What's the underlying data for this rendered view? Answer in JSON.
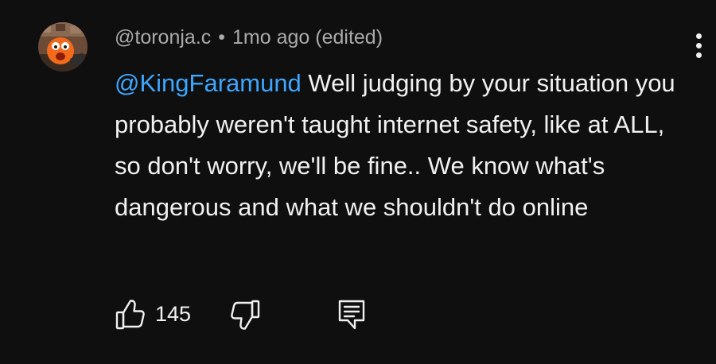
{
  "comment": {
    "author": "@toronja.c",
    "separator": "•",
    "timestamp": "1mo ago (edited)",
    "mention": "@KingFaramund",
    "text": " Well judging by your situation you probably weren't taught internet safety, like at ALL, so don't worry, we'll be fine.. We know what's dangerous and what we shouldn't do online",
    "like_count": "145"
  },
  "icons": {
    "avatar": "avatar",
    "menu": "more-vertical-icon",
    "like": "thumbs-up-icon",
    "dislike": "thumbs-down-icon",
    "reply": "comment-reply-icon"
  },
  "colors": {
    "background": "#0f0f0f",
    "text": "#f1f1f1",
    "meta": "#aaaaaa",
    "mention": "#3ea6ff"
  }
}
